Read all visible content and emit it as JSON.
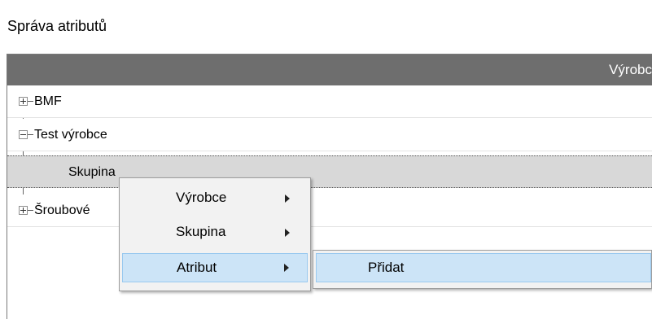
{
  "window": {
    "title": "Správa atributů"
  },
  "grid": {
    "column_header": "Výrobc",
    "rows": [
      {
        "label": "BMF",
        "expander": "plus"
      },
      {
        "label": "Test výrobce",
        "expander": "minus"
      },
      {
        "label": "Skupina"
      },
      {
        "label": "Šroubové",
        "expander": "plus"
      }
    ]
  },
  "context_menu": {
    "items": [
      {
        "label": "Výrobce",
        "has_submenu": true
      },
      {
        "label": "Skupina",
        "has_submenu": true
      },
      {
        "label": "Atribut",
        "has_submenu": true,
        "highlighted": true
      }
    ]
  },
  "submenu": {
    "items": [
      {
        "label": "Přidat"
      }
    ]
  },
  "colors": {
    "header_bg": "#6e6e6e",
    "selected_row_bg": "#d8d8d8",
    "menu_bg": "#f2f2f2",
    "menu_highlight": "#cce4f7"
  }
}
